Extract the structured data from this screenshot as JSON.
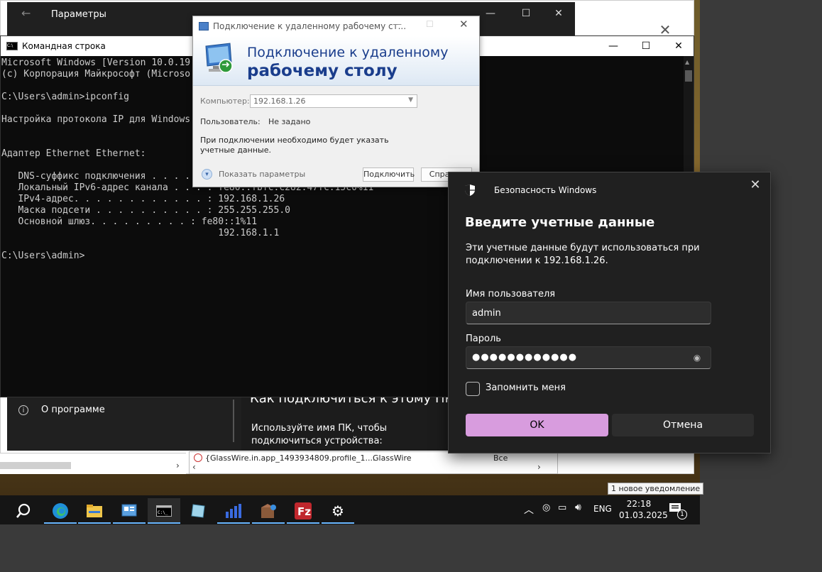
{
  "settings_window": {
    "title": "Параметры",
    "about_label": "О программе",
    "connect_heading": "Как подключиться к этому ПК",
    "connect_desc": "Используйте имя ПК, чтобы подключиться устройства:"
  },
  "list_row": {
    "name": "{GlassWire.in.app_1493934809.profile_1....",
    "app": "GlassWire",
    "scope": "Все"
  },
  "cmd_window": {
    "title": "Командная строка",
    "lines": [
      "Microsoft Windows [Version 10.0.19",
      "(c) Корпорация Майкрософт (Microsо",
      "",
      "C:\\Users\\admin>ipconfig",
      "",
      "Настройка протокола IP для Windows",
      "",
      "",
      "Адаптер Ethernet Ethernet:",
      "",
      "   DNS-суффикс подключения . . . .",
      "   Локальный IPv6-адрес канала . . . : fe80::fbfc:c282:47fc:15c0%11",
      "   IPv4-адрес. . . . . . . . . . . . : 192.168.1.26",
      "   Маска подсети . . . . . . . . . . : 255.255.255.0",
      "   Основной шлюз. . . . . . . . . : fe80::1%11",
      "                                       192.168.1.1",
      "",
      "C:\\Users\\admin>"
    ]
  },
  "rdp_dialog": {
    "title": "Подключение к удаленному рабочему ст...",
    "heading_line1": "Подключение к удаленному",
    "heading_line2": "рабочему столу",
    "computer_label": "Компьютер:",
    "computer_value": "192.168.1.26",
    "user_label": "Пользователь:",
    "user_value": "Не задано",
    "note": "При подключении необходимо будет указать учетные данные.",
    "show_options": "Показать параметры",
    "connect_button": "Подключить",
    "help_button": "Справка"
  },
  "security_dialog": {
    "app_name": "Безопасность Windows",
    "title": "Введите учетные данные",
    "description": "Эти учетные данные будут использоваться при подключении к 192.168.1.26.",
    "username_label": "Имя пользователя",
    "username_value": "admin",
    "password_label": "Пароль",
    "password_value": "●●●●●●●●●●●●",
    "remember_label": "Запомнить меня",
    "ok_label": "OK",
    "cancel_label": "Отмена",
    "ok_color": "#d89cde"
  },
  "taskbar": {
    "lang": "ENG",
    "time": "22:18",
    "date": "01.03.2025",
    "notification_count": "1",
    "tooltip": "1 новое уведомление",
    "apps": [
      "search-icon",
      "edge-icon",
      "explorer-icon",
      "control-panel-icon",
      "cmd-icon",
      "notes-icon",
      "glasswire-icon",
      "package-icon",
      "filezilla-icon",
      "settings-icon"
    ]
  }
}
